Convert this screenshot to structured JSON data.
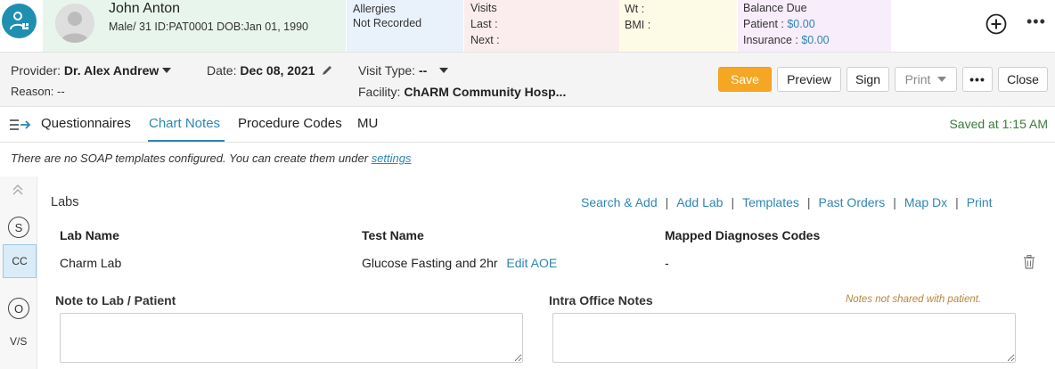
{
  "header": {
    "patient_name": "John Anton",
    "patient_info": "Male/ 31 ID:PAT0001 DOB:Jan 01, 1990",
    "allergies_label": "Allergies",
    "allergies_value": "Not Recorded",
    "visits_label": "Visits",
    "visits_last": "Last :",
    "visits_next": "Next :",
    "wt_label": "Wt :",
    "bmi_label": "BMI :",
    "balance_label": "Balance Due",
    "patient_balance_label": "Patient :",
    "patient_balance_value": "$0.00",
    "insurance_balance_label": "Insurance :",
    "insurance_balance_value": "$0.00"
  },
  "encounter": {
    "provider_label": "Provider:",
    "provider_value": "Dr. Alex Andrew",
    "date_label": "Date:",
    "date_value": "Dec 08, 2021",
    "visit_type_label": "Visit Type:",
    "visit_type_value": "--",
    "reason_label": "Reason:",
    "reason_value": "--",
    "facility_label": "Facility:",
    "facility_value": "ChARM Community Hosp...",
    "buttons": {
      "save": "Save",
      "preview": "Preview",
      "sign": "Sign",
      "print": "Print",
      "more": "•••",
      "close": "Close"
    }
  },
  "tabs": {
    "items": [
      "Questionnaires",
      "Chart Notes",
      "Procedure Codes",
      "MU"
    ],
    "active": "Chart Notes",
    "saved_status": "Saved at 1:15 AM"
  },
  "notice": {
    "text": "There are no SOAP templates configured. You can create them under ",
    "link": "settings"
  },
  "rail": {
    "items": [
      "S",
      "CC",
      "O",
      "V/S"
    ]
  },
  "labs": {
    "title": "Labs",
    "actions": [
      "Search & Add",
      "Add Lab",
      "Templates",
      "Past Orders",
      "Map Dx",
      "Print"
    ],
    "columns": [
      "Lab Name",
      "Test Name",
      "Mapped Diagnoses Codes"
    ],
    "rows": [
      {
        "lab_name": "Charm Lab",
        "test_name": "Glucose Fasting and 2hr",
        "edit_link": "Edit AOE",
        "diagnoses": "-"
      }
    ],
    "note_label": "Note to Lab / Patient",
    "intra_label": "Intra Office Notes",
    "intra_hint": "Notes not shared with patient."
  },
  "colors": {
    "accent": "#2e86b3",
    "save": "#f5a623",
    "logo": "#1e8fb0"
  }
}
